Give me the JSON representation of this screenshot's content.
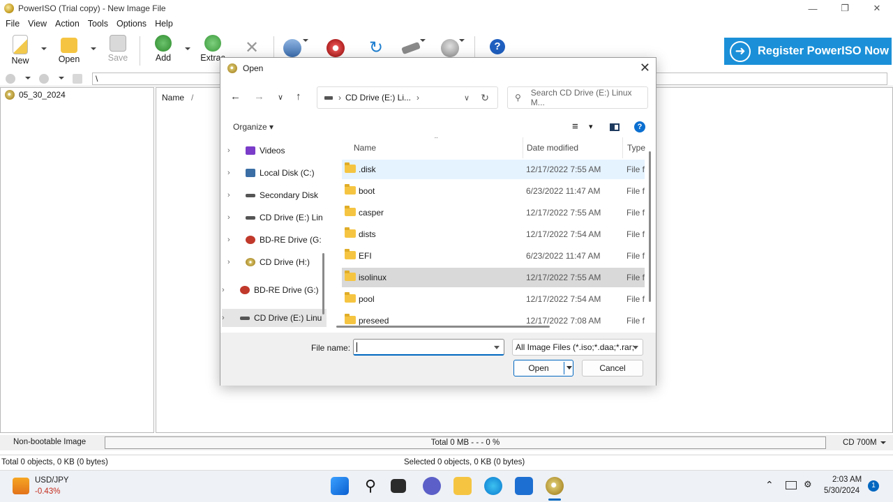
{
  "window": {
    "title": "PowerISO (Trial copy) - New Image File"
  },
  "menu": [
    "File",
    "View",
    "Action",
    "Tools",
    "Options",
    "Help"
  ],
  "toolbar": {
    "new_label": "New",
    "open_label": "Open",
    "save_label": "Save",
    "add_label": "Add",
    "extract_label": "Extrac"
  },
  "register_label": "Register PowerISO Now",
  "address": {
    "path": "\\"
  },
  "tree": {
    "root": "05_30_2024"
  },
  "main": {
    "name_header": "Name",
    "sort_mark": "/"
  },
  "status": {
    "boot": "Non-bootable Image",
    "progress": "Total  0 MB   - - -  0 %",
    "media": "CD 700M",
    "total_objects": "Total 0 objects, 0 KB (0 bytes)",
    "selected_objects": "Selected 0 objects, 0 KB (0 bytes)"
  },
  "taskbar": {
    "ticker_name": "USD/JPY",
    "ticker_change": "-0.43%",
    "time": "2:03 AM",
    "date": "5/30/2024",
    "notification_count": "1"
  },
  "dialog": {
    "title": "Open",
    "breadcrumb": "CD Drive (E:) Li...",
    "search_placeholder": "Search CD Drive (E:) Linux M...",
    "organize": "Organize",
    "side_items": [
      {
        "label": "Videos"
      },
      {
        "label": "Local Disk (C:)"
      },
      {
        "label": "Secondary Disk"
      },
      {
        "label": "CD Drive (E:) Lin"
      },
      {
        "label": "BD-RE Drive (G:"
      },
      {
        "label": "CD Drive (H:)"
      },
      {
        "label": "BD-RE Drive (G:)"
      },
      {
        "label": "CD Drive (E:) Linu"
      }
    ],
    "columns": {
      "name": "Name",
      "date": "Date modified",
      "type": "Type"
    },
    "files": [
      {
        "name": ".disk",
        "date": "12/17/2022 7:55 AM",
        "type": "File f"
      },
      {
        "name": "boot",
        "date": "6/23/2022 11:47 AM",
        "type": "File f"
      },
      {
        "name": "casper",
        "date": "12/17/2022 7:55 AM",
        "type": "File f"
      },
      {
        "name": "dists",
        "date": "12/17/2022 7:54 AM",
        "type": "File f"
      },
      {
        "name": "EFI",
        "date": "6/23/2022 11:47 AM",
        "type": "File f"
      },
      {
        "name": "isolinux",
        "date": "12/17/2022 7:55 AM",
        "type": "File f"
      },
      {
        "name": "pool",
        "date": "12/17/2022 7:54 AM",
        "type": "File f"
      },
      {
        "name": "preseed",
        "date": "12/17/2022 7:08 AM",
        "type": "File f"
      }
    ],
    "filename_label": "File name:",
    "filename_value": "",
    "filter": "All Image Files (*.iso;*.daa;*.rar;",
    "open_button": "Open",
    "cancel_button": "Cancel"
  },
  "colors": {
    "accent": "#0067c0",
    "register_bg": "#1b90d8",
    "folder": "#f5c542"
  }
}
